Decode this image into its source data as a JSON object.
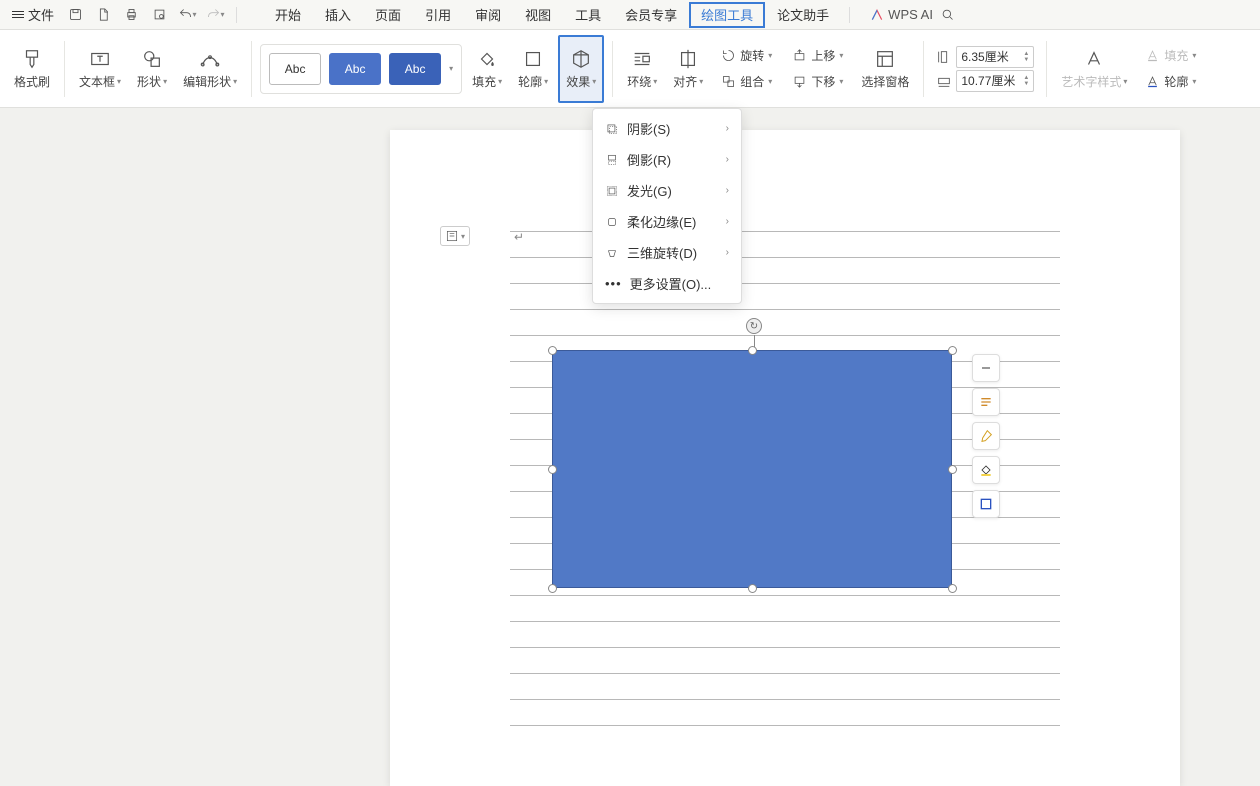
{
  "titlebar": {
    "file": "文件",
    "wps_ai": "WPS AI"
  },
  "tabs": [
    "开始",
    "插入",
    "页面",
    "引用",
    "审阅",
    "视图",
    "工具",
    "会员专享",
    "绘图工具",
    "论文助手"
  ],
  "tabs_active_index": 8,
  "ribbon": {
    "format_painter": "格式刷",
    "textbox": "文本框",
    "shape": "形状",
    "edit_shape": "编辑形状",
    "style_labels": [
      "Abc",
      "Abc",
      "Abc"
    ],
    "fill": "填充",
    "outline": "轮廓",
    "effect": "效果",
    "wrap": "环绕",
    "align": "对齐",
    "rotate": "旋转",
    "group": "组合",
    "up": "上移",
    "down": "下移",
    "select_pane": "选择窗格",
    "height": "6.35厘米",
    "width": "10.77厘米",
    "art_style": "艺术字样式",
    "fill2": "填充",
    "outline2": "轮廓"
  },
  "dropdown": {
    "shadow": "阴影(S)",
    "reflection": "倒影(R)",
    "glow": "发光(G)",
    "soft": "柔化边缘(E)",
    "rotate3d": "三维旋转(D)",
    "more": "更多设置(O)..."
  }
}
